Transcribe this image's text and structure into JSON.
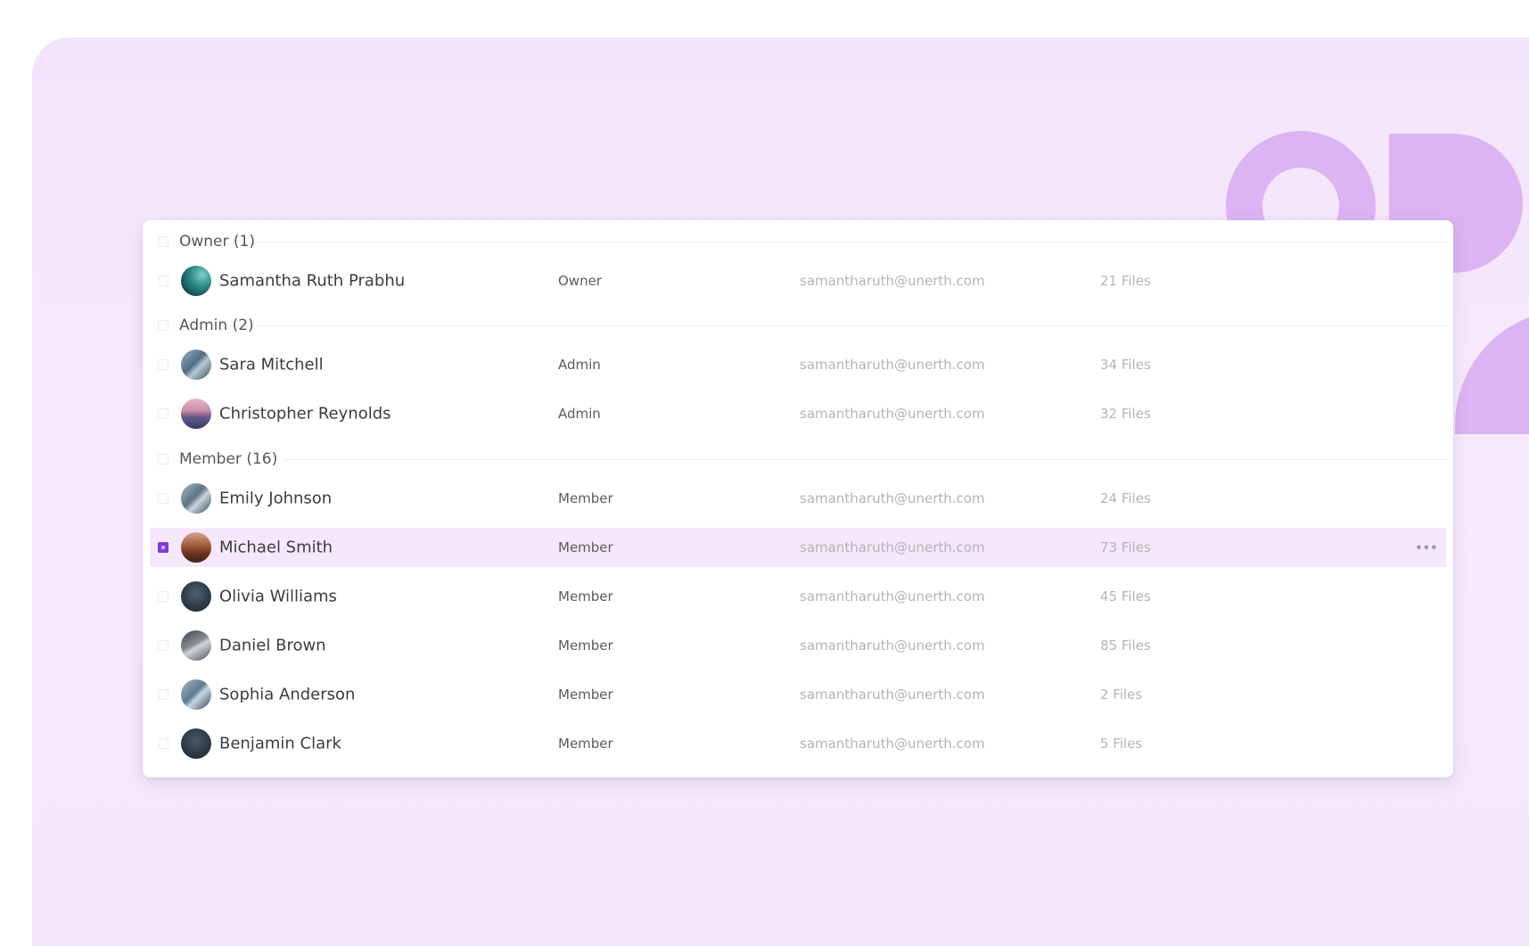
{
  "groups": [
    {
      "label": "Owner (1)",
      "members": [
        {
          "name": "Samantha Ruth Prabhu",
          "role": "Owner",
          "email": "samantharuth@unerth.com",
          "files": "21 Files"
        }
      ]
    },
    {
      "label": "Admin (2)",
      "members": [
        {
          "name": "Sara Mitchell",
          "role": "Admin",
          "email": "samantharuth@unerth.com",
          "files": "34 Files"
        },
        {
          "name": "Christopher Reynolds",
          "role": "Admin",
          "email": "samantharuth@unerth.com",
          "files": "32 Files"
        }
      ]
    },
    {
      "label": "Member (16)",
      "members": [
        {
          "name": "Emily Johnson",
          "role": "Member",
          "email": "samantharuth@unerth.com",
          "files": "24 Files"
        },
        {
          "name": "Michael Smith",
          "role": "Member",
          "email": "samantharuth@unerth.com",
          "files": "73 Files",
          "selected": true
        },
        {
          "name": "Olivia Williams",
          "role": "Member",
          "email": "samantharuth@unerth.com",
          "files": "45 Files"
        },
        {
          "name": "Daniel Brown",
          "role": "Member",
          "email": "samantharuth@unerth.com",
          "files": "85 Files"
        },
        {
          "name": "Sophia Anderson",
          "role": "Member",
          "email": "samantharuth@unerth.com",
          "files": "2 Files"
        },
        {
          "name": "Benjamin Clark",
          "role": "Member",
          "email": "samantharuth@unerth.com",
          "files": "5 Files"
        }
      ]
    }
  ],
  "selected_row_actions": "•••",
  "colors": {
    "accent": "#7a3ae0",
    "selected_row_bg": "#f5e8fc",
    "backdrop": "#f3e4fb",
    "decoration": "#dcb3f3"
  }
}
